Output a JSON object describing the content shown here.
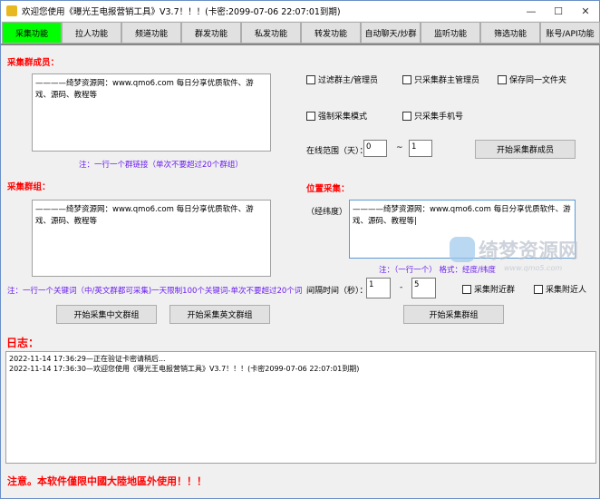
{
  "window": {
    "title": "欢迎您使用《曝光王电报营销工具》V3.7！！！(卡密:2099-07-06 22:07:01到期)",
    "minimize": "—",
    "maximize": "☐",
    "close": "✕"
  },
  "tabs": [
    {
      "label": "采集功能",
      "active": true
    },
    {
      "label": "拉人功能"
    },
    {
      "label": "频道功能"
    },
    {
      "label": "群发功能"
    },
    {
      "label": "私发功能"
    },
    {
      "label": "转发功能"
    },
    {
      "label": "自动聊天/炒群"
    },
    {
      "label": "监听功能"
    },
    {
      "label": "筛选功能"
    },
    {
      "label": "账号/API功能"
    }
  ],
  "members": {
    "heading": "采集群成员：",
    "text": "————绮梦资源网：www.qmo6.com 每日分享优质软件、游戏、源码、教程等",
    "note": "注：一行一个群链接（单次不要超过20个群组）",
    "options": [
      "过滤群主/管理员",
      "只采集群主管理员",
      "保存同一文件夹",
      "强制采集模式",
      "只采集手机号"
    ],
    "range_label": "在线范围（天）：",
    "range_from": "0",
    "range_sep": "~",
    "range_to": "1",
    "start_button": "开始采集群成员"
  },
  "groups": {
    "heading": "采集群组：",
    "text": "————绮梦资源网：www.qmo6.com 每日分享优质软件、游戏、源码、教程等",
    "note": "注：一行一个关键词（中/英文群都可采集)一天限制100个关键词-单次不要超过20个词",
    "cn_button": "开始采集中文群组",
    "en_button": "开始采集英文群组"
  },
  "location": {
    "heading": "位置采集：",
    "coord_label": "（经纬度）",
    "text": "————绮梦资源网：www.qmo6.com 每日分享优质软件、游戏、源码、教程等|",
    "note": "注：（一行一个） 格式：经度/纬度",
    "interval_label": "间隔时间（秒）：",
    "interval_from": "1",
    "interval_sep": "-",
    "interval_to": "5",
    "nearby_groups": "采集附近群",
    "nearby_people": "采集附近人",
    "start_button": "开始采集群组"
  },
  "log": {
    "heading": "日志：",
    "lines": [
      "2022-11-14 17:36:29—正在验证卡密请稍后...",
      "2022-11-14 17:36:30—欢迎您使用《曝光王电报营销工具》V3.7！！！(卡密2099-07-06 22:07:01到期)"
    ]
  },
  "footer": {
    "notice": "注意。本软件僅限中國大陸地區外使用！！！"
  },
  "watermark": {
    "text": "绮梦资源网",
    "url": "www.qmo5.com"
  },
  "colors": {
    "active_tab": "#00ff00",
    "heading": "#ff0000",
    "note": "#6a1cf0"
  }
}
